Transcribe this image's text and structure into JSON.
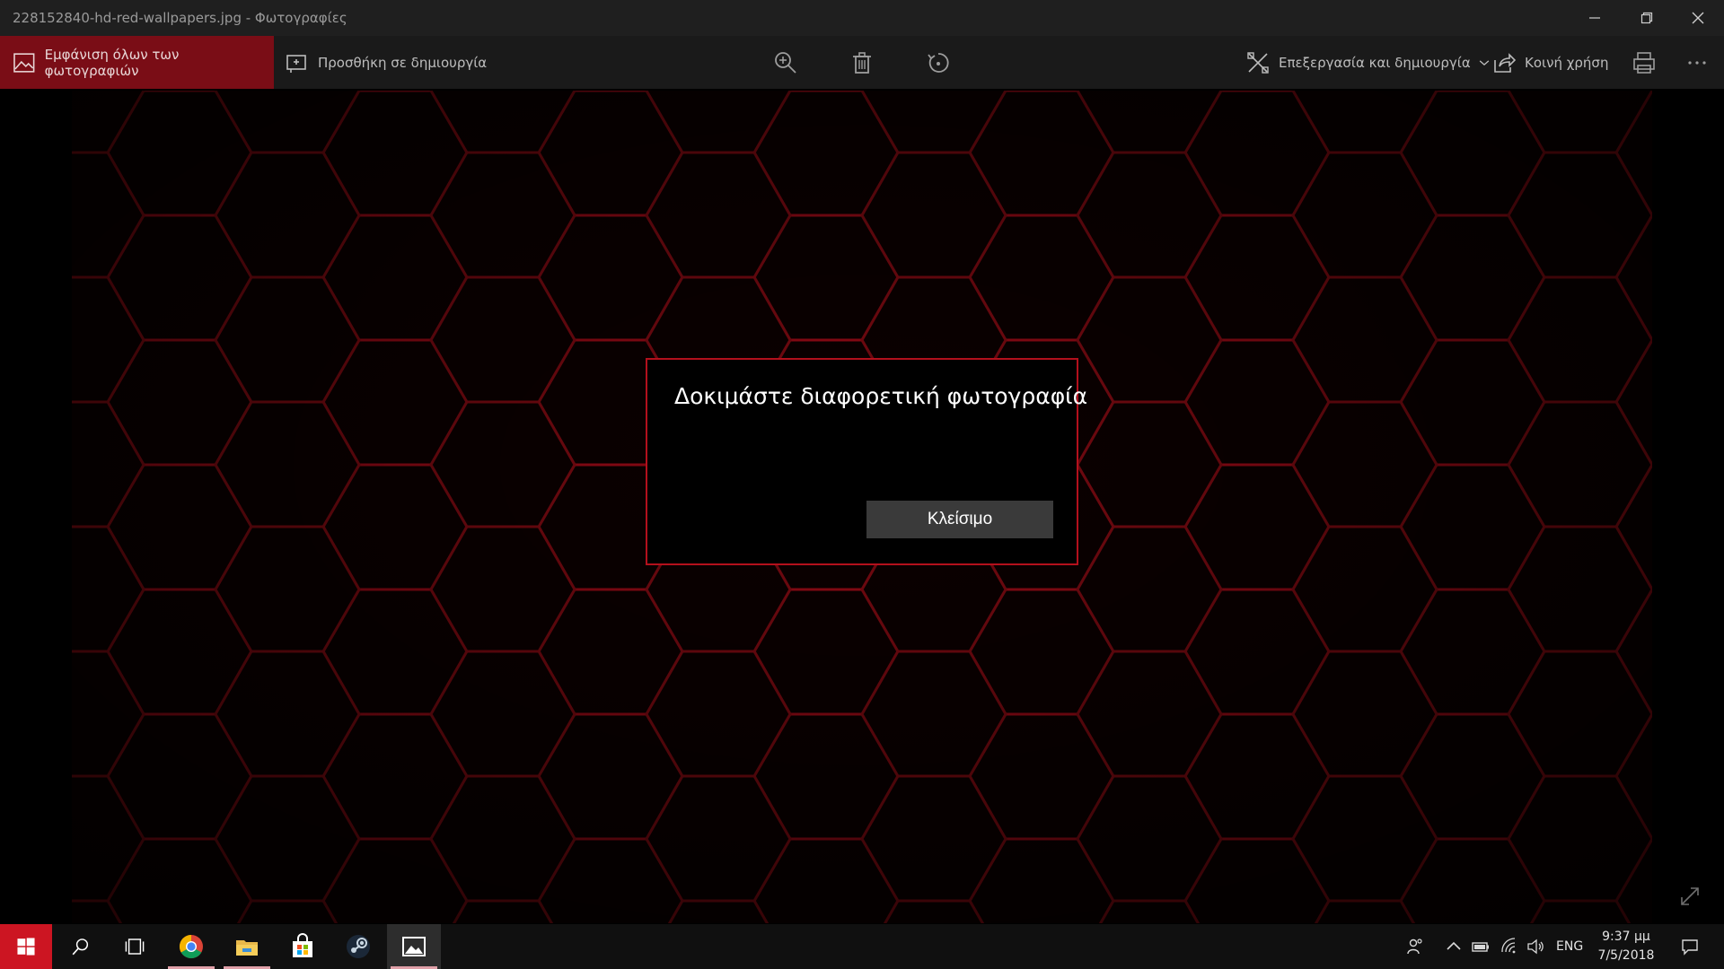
{
  "window": {
    "title": "228152840-hd-red-wallpapers.jpg - Φωτογραφίες",
    "minimize": "minimize",
    "maximize": "restore",
    "close": "close"
  },
  "toolbar": {
    "see_all": "Εμφάνιση όλων των φωτογραφιών",
    "add_to_creation": "Προσθήκη σε δημιουργία",
    "edit_create": "Επεξεργασία και δημιουργία",
    "share": "Κοινή χρήση"
  },
  "dialog": {
    "heading": "Δοκιμάστε διαφορετική φωτογραφία",
    "close_label": "Κλείσιμο"
  },
  "taskbar": {
    "language": "ENG",
    "time": "9:37 μμ",
    "date": "7/5/2018"
  },
  "colors": {
    "accent": "#7a0d16",
    "dialog_border": "#b3101c",
    "start_button": "#cc1522"
  }
}
